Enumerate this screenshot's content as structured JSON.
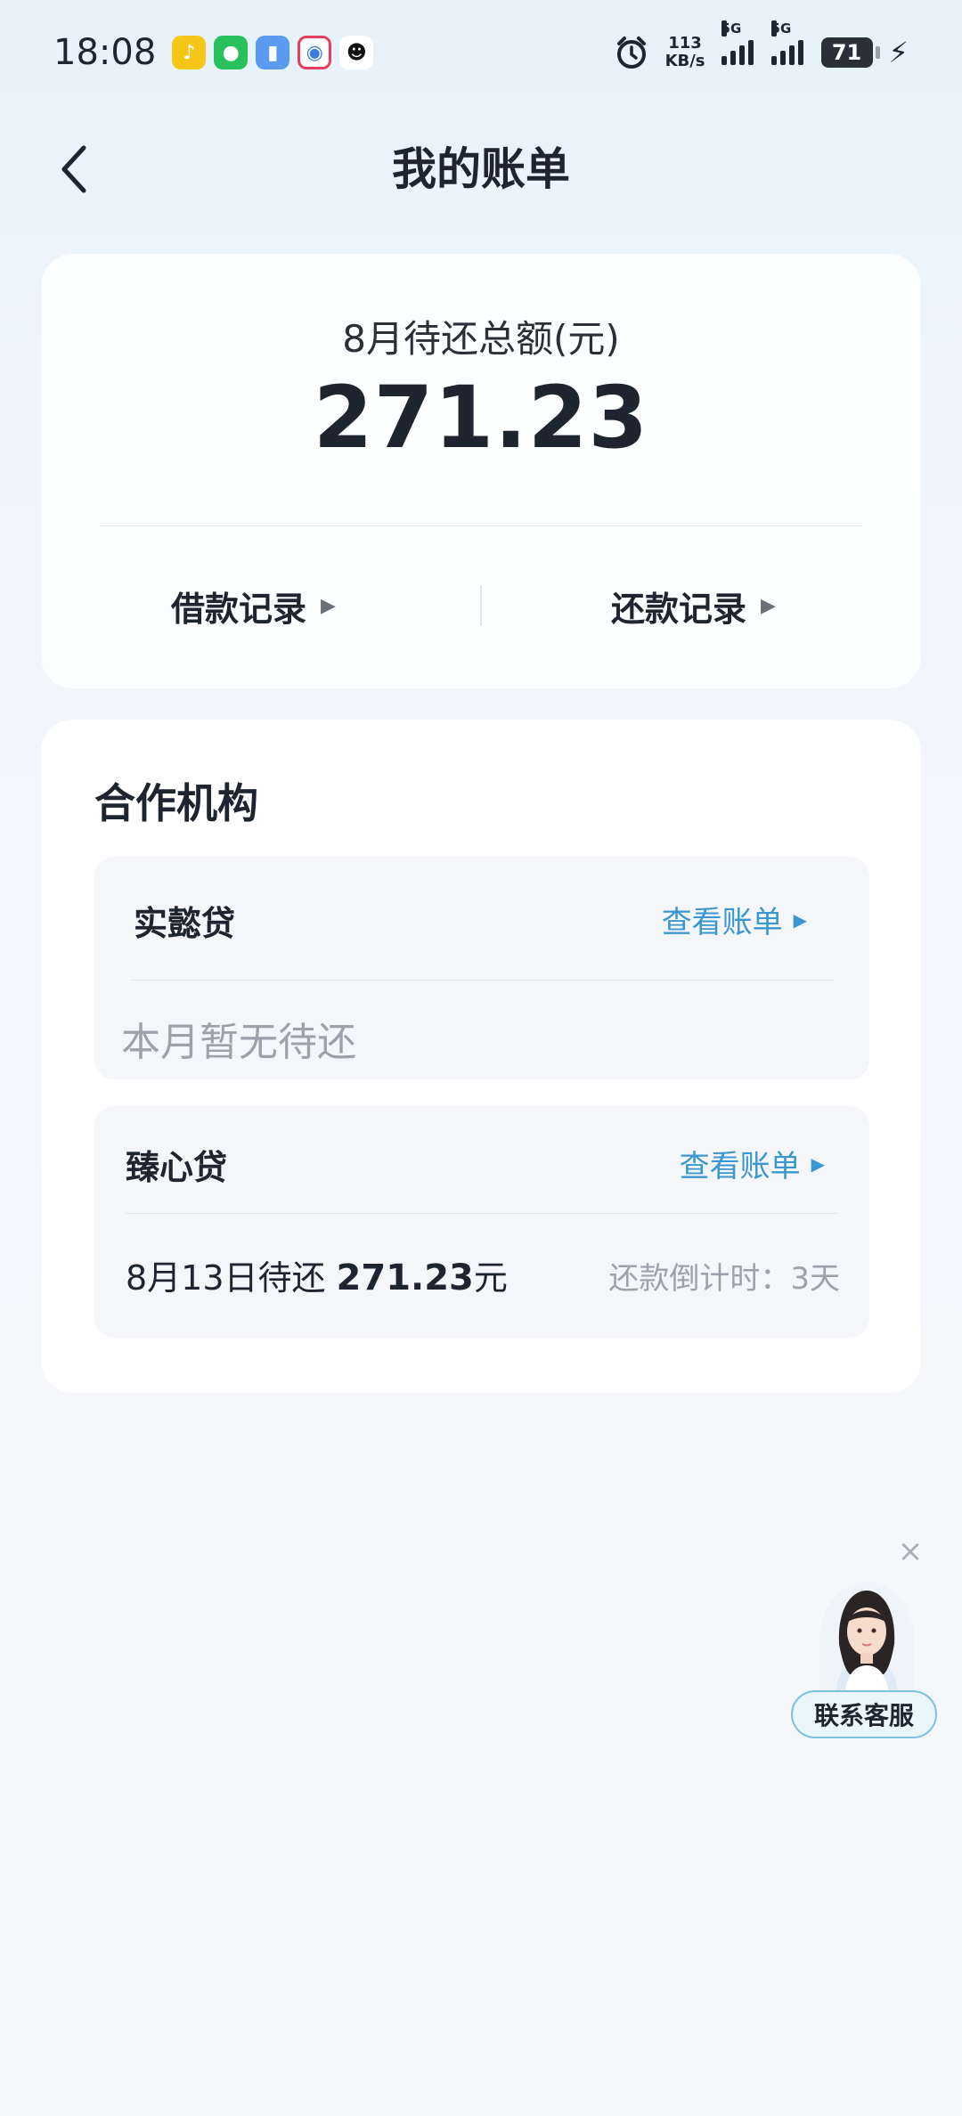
{
  "status_bar": {
    "time": "18:08",
    "net_speed_value": "113",
    "net_speed_unit": "KB/s",
    "sig1_label": "5G",
    "sig2_label": "5G",
    "battery": "71",
    "icons": [
      "music-app-icon",
      "wechat-icon",
      "file-app-icon",
      "video-app-icon",
      "qq-icon",
      "alarm-icon",
      "charging-icon"
    ]
  },
  "nav": {
    "title": "我的账单"
  },
  "summary": {
    "label": "8月待还总额(元)",
    "amount": "271.23",
    "borrow_record": "借款记录",
    "repay_record": "还款记录"
  },
  "partners": {
    "title": "合作机构",
    "lenders": [
      {
        "name": "实懿贷",
        "view_bill": "查看账单",
        "status": "本月暂无待还"
      },
      {
        "name": "臻心贷",
        "view_bill": "查看账单",
        "due_prefix": "8月13日待还",
        "due_amount": "271.23",
        "due_unit": "元",
        "countdown": "还款倒计时：3天"
      }
    ]
  },
  "customer_service": {
    "label": "联系客服"
  },
  "colors": {
    "accent": "#3a97cf",
    "text_primary": "#1e2430",
    "text_muted": "#9da2aa"
  }
}
